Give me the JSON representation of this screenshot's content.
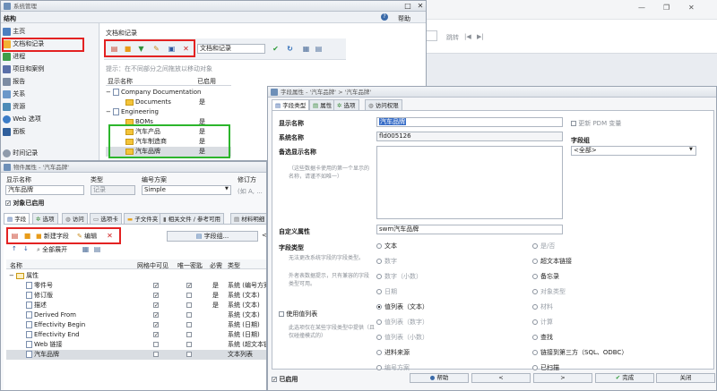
{
  "bg_window": {
    "page_label": "跳转",
    "pager_icons": [
      "|◀",
      "▶|"
    ],
    "win_controls": [
      "—",
      "❐",
      "✕"
    ]
  },
  "main_window": {
    "title": "系统管理",
    "structure_label": "结构",
    "help": "帮助",
    "nav": [
      {
        "label": "主页",
        "icon": "home-icon"
      },
      {
        "label": "文档和记录",
        "icon": "document-records-icon"
      },
      {
        "label": "进程",
        "icon": "process-icon"
      },
      {
        "label": "项目和案例",
        "icon": "project-icon"
      },
      {
        "label": "报告",
        "icon": "report-icon"
      },
      {
        "label": "关系",
        "icon": "relation-icon"
      },
      {
        "label": "资源",
        "icon": "resource-icon"
      },
      {
        "label": "Web 选项",
        "icon": "web-icon"
      },
      {
        "label": "面板",
        "icon": "panel-icon"
      },
      {
        "label": "时间记录",
        "icon": "time-record-icon"
      }
    ],
    "panel_title": "文档和记录",
    "panel_input_value": "文档和记录",
    "hint": "提示：在不同部分之间拖放以移动对象",
    "tree_headers": {
      "name": "显示名称",
      "enabled": "已启用"
    },
    "tree": [
      {
        "label": "Company Documentation",
        "level": 0,
        "type": "doc",
        "toggle": "−",
        "enabled": ""
      },
      {
        "label": "Documents",
        "level": 1,
        "type": "folder",
        "toggle": "",
        "enabled": "是"
      },
      {
        "label": "Engineering",
        "level": 0,
        "type": "doc",
        "toggle": "−",
        "enabled": ""
      },
      {
        "label": "BOMs",
        "level": 1,
        "type": "folder",
        "toggle": "",
        "enabled": "是"
      },
      {
        "label": "汽车产品",
        "level": 1,
        "type": "folder",
        "toggle": "",
        "enabled": "是"
      },
      {
        "label": "汽车制造商",
        "level": 1,
        "type": "folder",
        "toggle": "",
        "enabled": "是"
      },
      {
        "label": "汽车品牌",
        "level": 1,
        "type": "folder",
        "toggle": "",
        "enabled": "是"
      }
    ]
  },
  "object_window": {
    "title": "物件属性 - '汽车品牌'",
    "headers": {
      "display_name": "显示名称",
      "type": "类型",
      "numbering": "编号方案",
      "revision": "修订方"
    },
    "values": {
      "display_name": "汽车品牌",
      "type": "记录",
      "numbering": "Simple",
      "revision": "(如 A, ..."
    },
    "enabled_label": "对象已启用",
    "tabs": [
      "字段",
      "选项",
      "访问",
      "选项卡",
      "子文件夹",
      "相关文件 / 参考可用",
      "材料明细"
    ],
    "tools": {
      "new_field": "新建字段",
      "edit": "编辑",
      "field_group": "字段组...",
      "expand_all": "全部展开"
    },
    "table_headers": [
      "名称",
      "网格中可见",
      "唯一密匙",
      "必需",
      "类型"
    ],
    "group_label": "属性",
    "rows": [
      {
        "name": "零件号",
        "visible": true,
        "unique": true,
        "required": "是",
        "type": "系统 (编号方案)"
      },
      {
        "name": "修订版",
        "visible": true,
        "unique": false,
        "required": "是",
        "type": "系统 (文本)"
      },
      {
        "name": "描述",
        "visible": true,
        "unique": false,
        "required": "是",
        "type": "系统 (文本)"
      },
      {
        "name": "Derived From",
        "visible": true,
        "unique": false,
        "required": "",
        "type": "系统 (文本)"
      },
      {
        "name": "Effectivity Begin",
        "visible": true,
        "unique": false,
        "required": "",
        "type": "系统 (日期)"
      },
      {
        "name": "Effectivity End",
        "visible": true,
        "unique": false,
        "required": "",
        "type": "系统 (日期)"
      },
      {
        "name": "Web 链接",
        "visible": false,
        "unique": false,
        "required": "",
        "type": "系统 (超文本链)"
      },
      {
        "name": "汽车品牌",
        "visible": false,
        "unique": false,
        "required": "",
        "type": "文本列表"
      }
    ]
  },
  "field_dialog": {
    "title": "字段属性 - '汽车品牌' > '汽车品牌'",
    "tabs": [
      "字段类型",
      "属性",
      "选项",
      "访问权限"
    ],
    "display_name_label": "显示名称",
    "display_name_value": "汽车品牌",
    "pdm_label": "更新 PDM 变量",
    "system_name_label": "系统名称",
    "system_name_value": "fld005126",
    "alt_name_label": "备选显示名称",
    "alt_name_hint": "（这些数据卡使用的第一个显示的名称，请谨不如唯一）",
    "field_group_label": "字段组",
    "field_group_value": "<全部>",
    "custom_attr_label": "自定义属性",
    "custom_attr_value": "swm汽车品牌",
    "field_type_label": "字段类型",
    "field_type_hint": "无法更改系统字段的字段类型。",
    "data_hint": "外者表数据提示，只有兼容的字段类型可用。",
    "use_lookup_label": "使用值列表",
    "lookup_hint": "此选项仅在某些字段类型中提供（且仅碰撞模式的）",
    "types_left": [
      {
        "label": "文本",
        "on": false,
        "dim": false
      },
      {
        "label": "数字",
        "on": false,
        "dim": true
      },
      {
        "label": "数字（小数）",
        "on": false,
        "dim": true
      },
      {
        "label": "日期",
        "on": false,
        "dim": true
      },
      {
        "label": "值列表（文本）",
        "on": true,
        "dim": false
      },
      {
        "label": "值列表（数字）",
        "on": false,
        "dim": true
      },
      {
        "label": "值列表（小数）",
        "on": false,
        "dim": true
      },
      {
        "label": "进料来源",
        "on": false,
        "dim": false
      },
      {
        "label": "编号方案",
        "on": false,
        "dim": true
      }
    ],
    "types_right": [
      {
        "label": "是/否",
        "on": false,
        "dim": true
      },
      {
        "label": "超文本链接",
        "on": false,
        "dim": false
      },
      {
        "label": "备忘录",
        "on": false,
        "dim": false
      },
      {
        "label": "对象类型",
        "on": false,
        "dim": true
      },
      {
        "label": "材料",
        "on": false,
        "dim": true
      },
      {
        "label": "计算",
        "on": false,
        "dim": true
      },
      {
        "label": "查找",
        "on": false,
        "dim": false
      },
      {
        "label": "链接到第三方（SQL、ODBC）",
        "on": false,
        "dim": false
      },
      {
        "label": "已扫描",
        "on": false,
        "dim": false
      }
    ],
    "enabled_label": "已启用",
    "buttons": {
      "help": "帮助",
      "prev": "<",
      "next": ">",
      "finish": "完成",
      "close": "关闭"
    }
  }
}
